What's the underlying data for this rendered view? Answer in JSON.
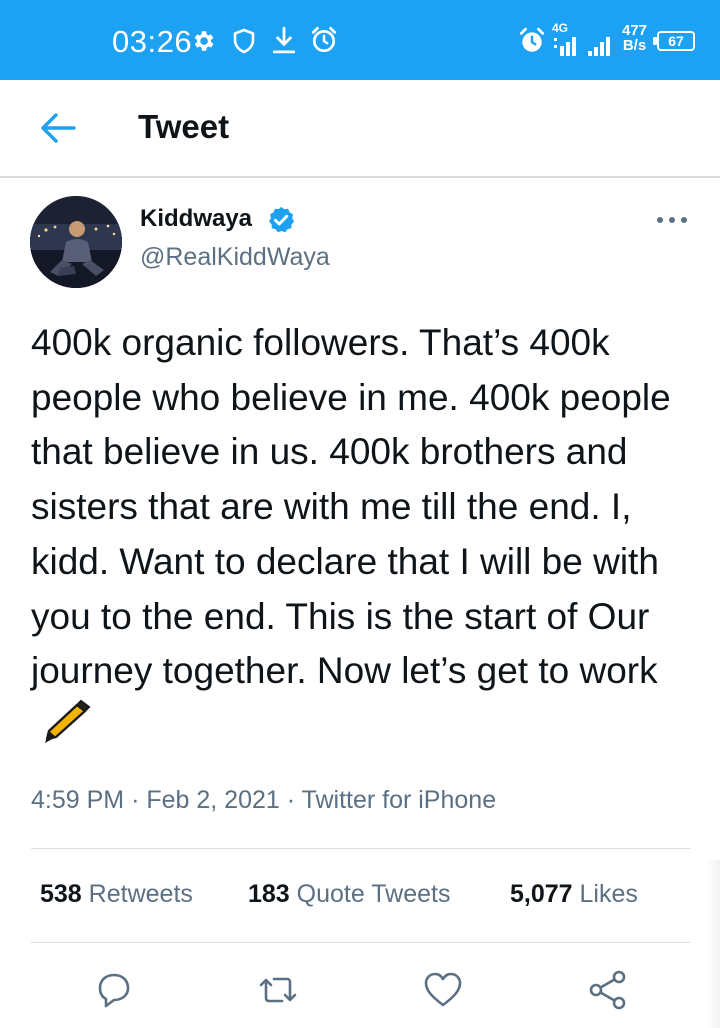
{
  "status_bar": {
    "time": "03:26",
    "icons_left": [
      "gear-icon",
      "shield-icon",
      "download-icon",
      "alarm-icon"
    ],
    "icons_right": [
      "alarm-icon",
      "signal-4g-icon",
      "signal-icon"
    ],
    "network_type": "4G",
    "speed_value": "477",
    "speed_unit": "B/s",
    "battery": "67",
    "background": "#1da1f2"
  },
  "header": {
    "back_icon": "back-arrow-icon",
    "title": "Tweet"
  },
  "tweet": {
    "author": {
      "name": "Kiddwaya",
      "handle": "@RealKiddWaya",
      "verified": true
    },
    "text": "400k organic followers. That’s 400k people who believe in me. 400k people that believe in us. 400k brothers and sisters that are with me till the end. I, kidd. Want to declare that I will be with you to the end. This is the start of Our journey together. Now let’s get to work",
    "emoji": "pen-icon",
    "time": "4:59 PM",
    "separator": "·",
    "date": "Feb 2, 2021",
    "source": "Twitter for iPhone"
  },
  "stats": [
    {
      "count": "538",
      "label": "Retweets"
    },
    {
      "count": "183",
      "label": "Quote Tweets"
    },
    {
      "count": "5,077",
      "label": "Likes"
    }
  ],
  "actions": [
    "reply-icon",
    "retweet-icon",
    "like-icon",
    "share-icon"
  ],
  "colors": {
    "accent": "#1da1f2",
    "text_primary": "#0f1419",
    "text_secondary": "#5b7083",
    "divider": "#d9dee2"
  }
}
